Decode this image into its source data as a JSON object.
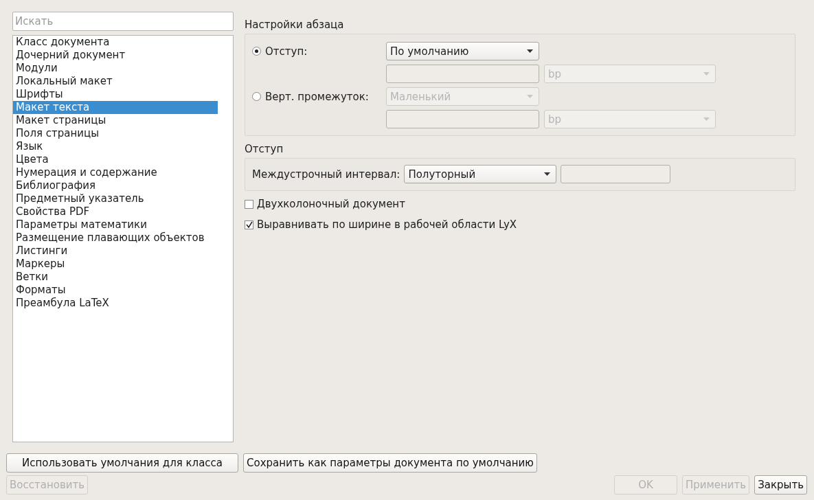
{
  "search": {
    "placeholder": "Искать"
  },
  "categories": [
    {
      "label": "Класс документа",
      "selected": false
    },
    {
      "label": "Дочерний документ",
      "selected": false
    },
    {
      "label": "Модули",
      "selected": false
    },
    {
      "label": "Локальный макет",
      "selected": false
    },
    {
      "label": "Шрифты",
      "selected": false
    },
    {
      "label": "Макет текста",
      "selected": true
    },
    {
      "label": "Макет страницы",
      "selected": false
    },
    {
      "label": "Поля страницы",
      "selected": false
    },
    {
      "label": "Язык",
      "selected": false
    },
    {
      "label": "Цвета",
      "selected": false
    },
    {
      "label": "Нумерация и содержание",
      "selected": false
    },
    {
      "label": "Библиография",
      "selected": false
    },
    {
      "label": "Предметный указатель",
      "selected": false
    },
    {
      "label": "Свойства PDF",
      "selected": false
    },
    {
      "label": "Параметры математики",
      "selected": false
    },
    {
      "label": "Размещение плавающих объектов",
      "selected": false
    },
    {
      "label": "Листинги",
      "selected": false
    },
    {
      "label": "Маркеры",
      "selected": false
    },
    {
      "label": "Ветки",
      "selected": false
    },
    {
      "label": "Форматы",
      "selected": false
    },
    {
      "label": "Преамбула LaTeX",
      "selected": false
    }
  ],
  "paragraph_settings": {
    "title": "Настройки абзаца",
    "options": [
      {
        "label": "Отступ:",
        "selected": true,
        "select": {
          "value": "По умолчанию",
          "disabled": false
        },
        "length": {
          "disabled": false
        },
        "unit": {
          "value": "bp",
          "disabled": true
        }
      },
      {
        "label": "Верт. промежуток:",
        "selected": false,
        "select": {
          "value": "Маленький",
          "disabled": true
        },
        "length": {
          "disabled": false
        },
        "unit": {
          "value": "bp",
          "disabled": true
        }
      }
    ]
  },
  "spacing": {
    "title": "Отступ",
    "label": "Междустрочный интервал:",
    "select": {
      "value": "Полуторный",
      "disabled": false
    },
    "value_field": {
      "disabled": false
    }
  },
  "checkboxes": [
    {
      "label": "Двухколоночный документ",
      "checked": false
    },
    {
      "label": "Выравнивать по ширине в рабочей области LyX",
      "checked": true
    }
  ],
  "default_buttons": [
    {
      "label": "Использовать умолчания для класса",
      "disabled": false
    },
    {
      "label": "Сохранить как параметры документа по умолчанию",
      "disabled": false
    }
  ],
  "restore_button": {
    "label": "Восстановить",
    "disabled": true
  },
  "dialog_buttons": [
    {
      "label": "OK",
      "disabled": true
    },
    {
      "label": "Применить",
      "disabled": true
    },
    {
      "label": "Закрыть",
      "disabled": false
    }
  ]
}
